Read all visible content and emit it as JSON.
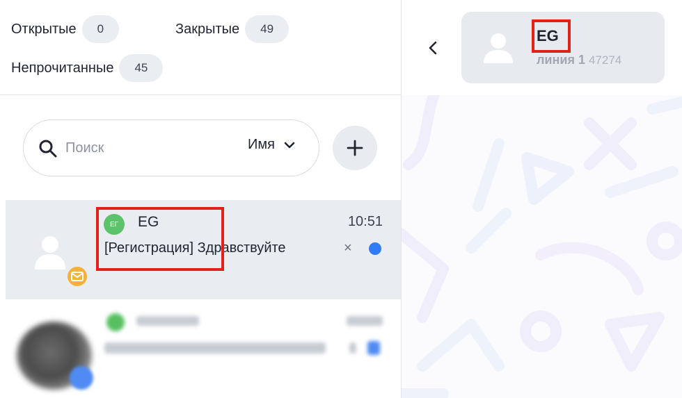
{
  "filters": {
    "open": {
      "label": "Открытые",
      "count": "0"
    },
    "closed": {
      "label": "Закрытые",
      "count": "49"
    },
    "unread": {
      "label": "Непрочитанные",
      "count": "45"
    }
  },
  "search": {
    "placeholder": "Поиск",
    "sort_label": "Имя"
  },
  "chats": [
    {
      "avatar_initials": "ЕГ",
      "name": "EG",
      "time": "10:51",
      "preview": "[Регистрация] Здравствуйте",
      "close_glyph": "×",
      "channel_icon": "mail-icon"
    }
  ],
  "contact": {
    "name": "EG",
    "line_label": "линия 1",
    "line_number": "47274"
  },
  "colors": {
    "accent_blue": "#2f7cf6",
    "highlight_red": "#e0221b",
    "mail_badge": "#f3b33a",
    "avatar_green": "#5cc36a",
    "pill_bg": "#eaedf2"
  }
}
